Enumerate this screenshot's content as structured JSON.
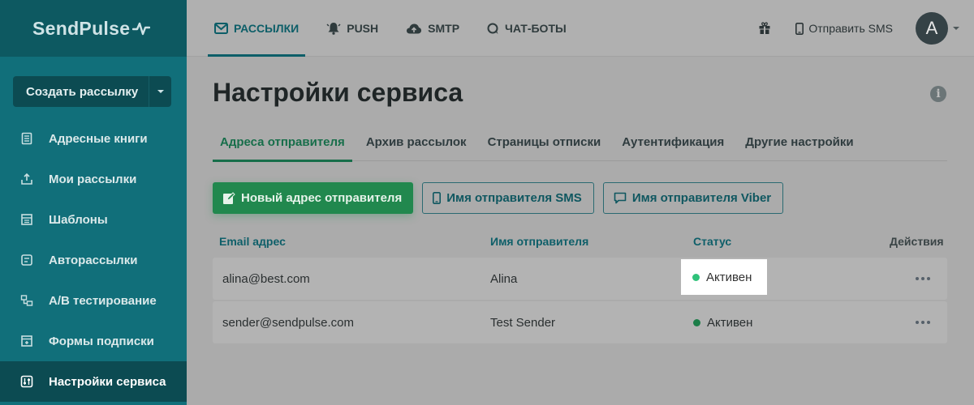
{
  "brand": {
    "logo_text": "SendPulse"
  },
  "sidebar": {
    "create_button": "Создать рассылку",
    "items": [
      {
        "label": "Адресные книги",
        "icon": "address-book-icon"
      },
      {
        "label": "Мои рассылки",
        "icon": "campaigns-icon"
      },
      {
        "label": "Шаблоны",
        "icon": "templates-icon"
      },
      {
        "label": "Авторассылки",
        "icon": "automation-icon"
      },
      {
        "label": "A/B тестирование",
        "icon": "ab-test-icon"
      },
      {
        "label": "Формы подписки",
        "icon": "forms-icon"
      },
      {
        "label": "Настройки сервиса",
        "icon": "settings-sliders-icon",
        "active": true
      }
    ]
  },
  "topnav": {
    "items": [
      {
        "label": "РАССЫЛКИ",
        "icon": "envelope-icon",
        "active": true
      },
      {
        "label": "PUSH",
        "icon": "bell-icon"
      },
      {
        "label": "SMTP",
        "icon": "cloud-upload-icon"
      },
      {
        "label": "ЧАТ-БОТЫ",
        "icon": "chat-icon"
      }
    ],
    "sms_link": "Отправить SMS",
    "avatar_letter": "A"
  },
  "page": {
    "title": "Настройки сервиса",
    "tabs": [
      {
        "label": "Адреса отправителя",
        "active": true
      },
      {
        "label": "Архив рассылок"
      },
      {
        "label": "Страницы отписки"
      },
      {
        "label": "Аутентификация"
      },
      {
        "label": "Другие настройки"
      }
    ],
    "buttons": {
      "new_sender": "Новый адрес отправителя",
      "sms_sender": "Имя отправителя SMS",
      "viber_sender": "Имя отправителя Viber"
    },
    "table": {
      "headers": {
        "email": "Email адрес",
        "name": "Имя отправителя",
        "status": "Статус",
        "actions": "Действия"
      },
      "rows": [
        {
          "email": "alina@best.com",
          "name": "Alina",
          "status": "Активен"
        },
        {
          "email": "sender@sendpulse.com",
          "name": "Test Sender",
          "status": "Активен"
        }
      ]
    }
  },
  "colors": {
    "sidebar": "#116f7a",
    "accent_green": "#21884e",
    "active_dot": "#2fc27a"
  }
}
